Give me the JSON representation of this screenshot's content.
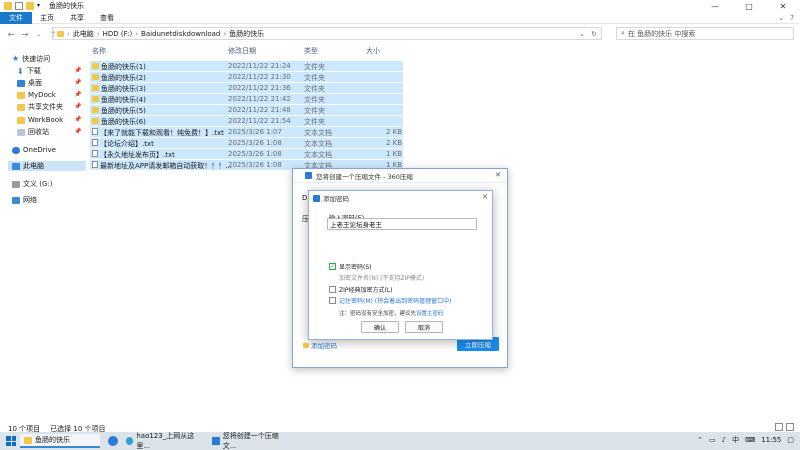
{
  "window": {
    "title": "鱼肠的快乐",
    "controls": [
      "—",
      "□",
      "✕"
    ]
  },
  "ribbon": {
    "tabs": [
      "文件",
      "主页",
      "共享",
      "查看"
    ]
  },
  "address": {
    "segments": [
      "此电脑",
      "HDD (F:)",
      "Baidunetdiskdownload",
      "鱼肠的快乐"
    ],
    "search_placeholder": "在 鱼肠的快乐 中搜索"
  },
  "sidebar": {
    "items": [
      {
        "label": "快速访问",
        "icon": "star-icon"
      },
      {
        "label": "下载",
        "icon": "download-icon",
        "pinned": true
      },
      {
        "label": "桌面",
        "icon": "desktop-icon",
        "pinned": true
      },
      {
        "label": "MyDock",
        "icon": "folder-icon",
        "pinned": true
      },
      {
        "label": "共享文件夹",
        "icon": "folder-icon",
        "pinned": true
      },
      {
        "label": "WorkBook",
        "icon": "folder-icon",
        "pinned": true
      },
      {
        "label": "回收站",
        "icon": "recycle-bin-icon",
        "pinned": true
      },
      {
        "label": "OneDrive",
        "icon": "cloud-icon"
      },
      {
        "label": "此电脑",
        "icon": "pc-icon"
      },
      {
        "label": "文义 (G:)",
        "icon": "drive-icon"
      },
      {
        "label": "网络",
        "icon": "network-icon"
      }
    ]
  },
  "columns": [
    "名称",
    "修改日期",
    "类型",
    "大小"
  ],
  "files": [
    {
      "name": "鱼肠的快乐(1)",
      "date": "2022/11/22 21:24",
      "type": "文件夹",
      "size": "",
      "kind": "folder"
    },
    {
      "name": "鱼肠的快乐(2)",
      "date": "2022/11/22 21:30",
      "type": "文件夹",
      "size": "",
      "kind": "folder"
    },
    {
      "name": "鱼肠的快乐(3)",
      "date": "2022/11/22 21:36",
      "type": "文件夹",
      "size": "",
      "kind": "folder"
    },
    {
      "name": "鱼肠的快乐(4)",
      "date": "2022/11/22 21:42",
      "type": "文件夹",
      "size": "",
      "kind": "folder"
    },
    {
      "name": "鱼肠的快乐(5)",
      "date": "2022/11/22 21:48",
      "type": "文件夹",
      "size": "",
      "kind": "folder"
    },
    {
      "name": "鱼肠的快乐(6)",
      "date": "2022/11/22 21:54",
      "type": "文件夹",
      "size": "",
      "kind": "folder"
    },
    {
      "name": "【来了就能下载和观看！纯免费！】.txt",
      "date": "2025/3/26 1:07",
      "type": "文本文档",
      "size": "2 KB",
      "kind": "file"
    },
    {
      "name": "【论坛介绍】.txt",
      "date": "2025/3/26 1:08",
      "type": "文本文档",
      "size": "2 KB",
      "kind": "file"
    },
    {
      "name": "【永久地址发布页】.txt",
      "date": "2025/3/26 1:08",
      "type": "文本文档",
      "size": "1 KB",
      "kind": "file"
    },
    {
      "name": "最新地址及APP请发邮箱自动获取！！！...",
      "date": "2025/3/26 1:08",
      "type": "文本文档",
      "size": "1 KB",
      "kind": "file"
    }
  ],
  "status": {
    "count": "10 个项目",
    "selected": "已选择 10 个项目"
  },
  "dialog360": {
    "title": "您将创建一个压缩文件 - 360压缩",
    "peek_1": "D",
    "peek_2": "压",
    "add_password": "添加密码",
    "start_button": "立即压缩"
  },
  "pwdialog": {
    "title": "添加密码",
    "label": "输入密码(E)",
    "value": "上老王论坛身老王",
    "show_password": "显示密码(S)",
    "encrypt_filename": "加密文件名(N) (不支持ZIP模式)",
    "zip_classic": "ZIP经典加密方式(L)",
    "remember": "记住密码(M) (将会着出到密码管理窗口中)",
    "note_prefix": "注：密码没有安全加密，建议先",
    "note_link": "设置主密码",
    "ok": "确认",
    "cancel": "取消"
  },
  "taskbar": {
    "apps": [
      {
        "label": "鱼肠的快乐",
        "icon": "folder-icon"
      },
      {
        "label": "hao123_上网从这里...",
        "icon": "browser-icon"
      },
      {
        "label": "您将创建一个压缩文...",
        "icon": "archive-icon"
      }
    ],
    "tray_lang": "中",
    "time": "11:55"
  },
  "colors": {
    "accent": "#1979ca",
    "selection": "#cce8ff",
    "link": "#2a7bd3",
    "folder": "#f2c84b"
  }
}
